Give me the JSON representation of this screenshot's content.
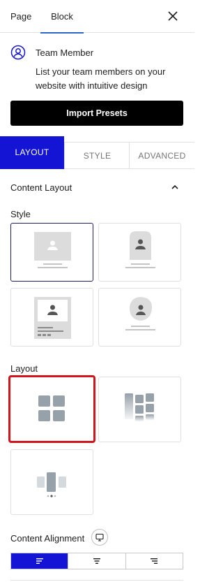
{
  "header": {
    "tabs": [
      {
        "label": "Page",
        "active": false
      },
      {
        "label": "Block",
        "active": true
      }
    ],
    "close_icon": "close-icon",
    "accent_color": "#2c64c8"
  },
  "block": {
    "icon": "user-circle-icon",
    "title": "Team Member",
    "description": "List your team members on your website with intuitive design"
  },
  "import_button": {
    "label": "Import Presets"
  },
  "section_tabs": [
    {
      "label": "LAYOUT",
      "active": true
    },
    {
      "label": "STYLE",
      "active": false
    },
    {
      "label": "ADVANCED",
      "active": false
    }
  ],
  "panel": {
    "title": "Content Layout",
    "expanded": true,
    "style_label": "Style",
    "style_options": [
      {
        "name": "style-1",
        "selected": true
      },
      {
        "name": "style-2",
        "selected": false
      },
      {
        "name": "style-3",
        "selected": false
      },
      {
        "name": "style-4",
        "selected": false
      }
    ],
    "layout_label": "Layout",
    "layout_options": [
      {
        "name": "grid",
        "selected": true
      },
      {
        "name": "masonry",
        "selected": false
      },
      {
        "name": "carousel",
        "selected": false
      }
    ],
    "alignment_label": "Content Alignment",
    "alignment_options": [
      {
        "name": "left",
        "active": true
      },
      {
        "name": "center",
        "active": false
      },
      {
        "name": "right",
        "active": false
      }
    ]
  },
  "colors": {
    "primary": "#1414d4",
    "highlight": "#d0161c",
    "placeholder": "#dcdcdc"
  }
}
